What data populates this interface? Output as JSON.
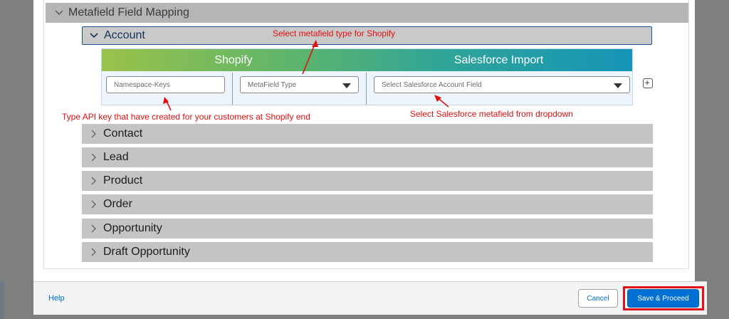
{
  "section": {
    "title": "Metafield Field Mapping"
  },
  "account": {
    "label": "Account",
    "headers": {
      "shopify": "Shopify",
      "salesforce": "Salesforce Import"
    },
    "namespace_placeholder": "Namespace-Keys",
    "metafield_type_value": "MetaField Type",
    "salesforce_field_value": "Select Salesforce Account Field"
  },
  "objects": [
    "Contact",
    "Lead",
    "Product",
    "Order",
    "Opportunity",
    "Draft Opportunity"
  ],
  "annotations": {
    "type_note": "Select metafield type for Shopify",
    "api_key_note": "Type API key that have created for your customers at Shopify end",
    "sf_note": "Select Salesforce metafield from dropdown"
  },
  "footer": {
    "help": "Help",
    "cancel": "Cancel",
    "proceed": "Save & Proceed"
  },
  "colors": {
    "annotation": "#e01010",
    "primary": "#0070d2",
    "highlight": "#e0101a"
  },
  "icons": {
    "expanded": "chevron-down-icon",
    "collapsed": "chevron-right-icon",
    "add": "plus-icon",
    "dropdown": "caret-down-icon"
  }
}
